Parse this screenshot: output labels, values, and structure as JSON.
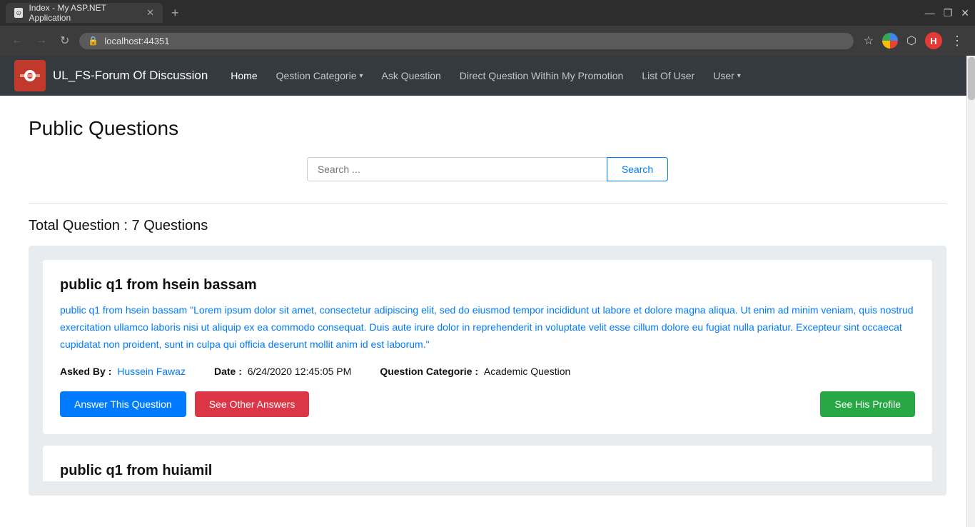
{
  "browser": {
    "tab_title": "Index - My ASP.NET Application",
    "tab_new": "+",
    "address": "localhost:44351",
    "lock_icon": "🔒",
    "win_minimize": "—",
    "win_maximize": "❐",
    "win_close": "✕",
    "back_btn": "←",
    "forward_btn": "→",
    "refresh_btn": "↻"
  },
  "navbar": {
    "brand_name": "UL_FS-Forum Of Discussion",
    "brand_logo_text": "🔴",
    "links": [
      {
        "label": "Home",
        "active": true
      },
      {
        "label": "Qestion Categorie",
        "dropdown": true
      },
      {
        "label": "Ask Question"
      },
      {
        "label": "Direct Question Within My Promotion"
      },
      {
        "label": "List Of User"
      },
      {
        "label": "User",
        "dropdown": true
      }
    ]
  },
  "page": {
    "title": "Public Questions",
    "search_placeholder": "Search ...",
    "search_btn": "Search",
    "total_label": "Total Question : 7 Questions"
  },
  "questions": [
    {
      "id": "q1",
      "title": "public q1 from hsein bassam",
      "body_prefix": "public q1 from hsein bassam",
      "body_lorem": "\"Lorem ipsum dolor sit amet, consectetur adipiscing elit, sed do eiusmod tempor incididunt ut labore et dolore magna aliqua. Ut enim ad minim veniam, quis nostrud exercitation ullamco laboris nisi ut aliquip ex ea commodo consequat. Duis aute irure dolor in reprehenderit in voluptate velit esse cillum dolore eu fugiat nulla pariatur. Excepteur sint occaecat cupidatat non proident, sunt in culpa qui officia deserunt mollit anim id est laborum.\"",
      "asked_by_label": "Asked By :",
      "asked_by_value": "Hussein Fawaz",
      "date_label": "Date :",
      "date_value": "6/24/2020 12:45:05 PM",
      "category_label": "Question Categorie :",
      "category_value": "Academic Question",
      "btn_answer": "Answer This Question",
      "btn_other": "See Other Answers",
      "btn_profile": "See His Profile"
    }
  ],
  "partial_card": {
    "title": "public q1 from huiamil"
  }
}
